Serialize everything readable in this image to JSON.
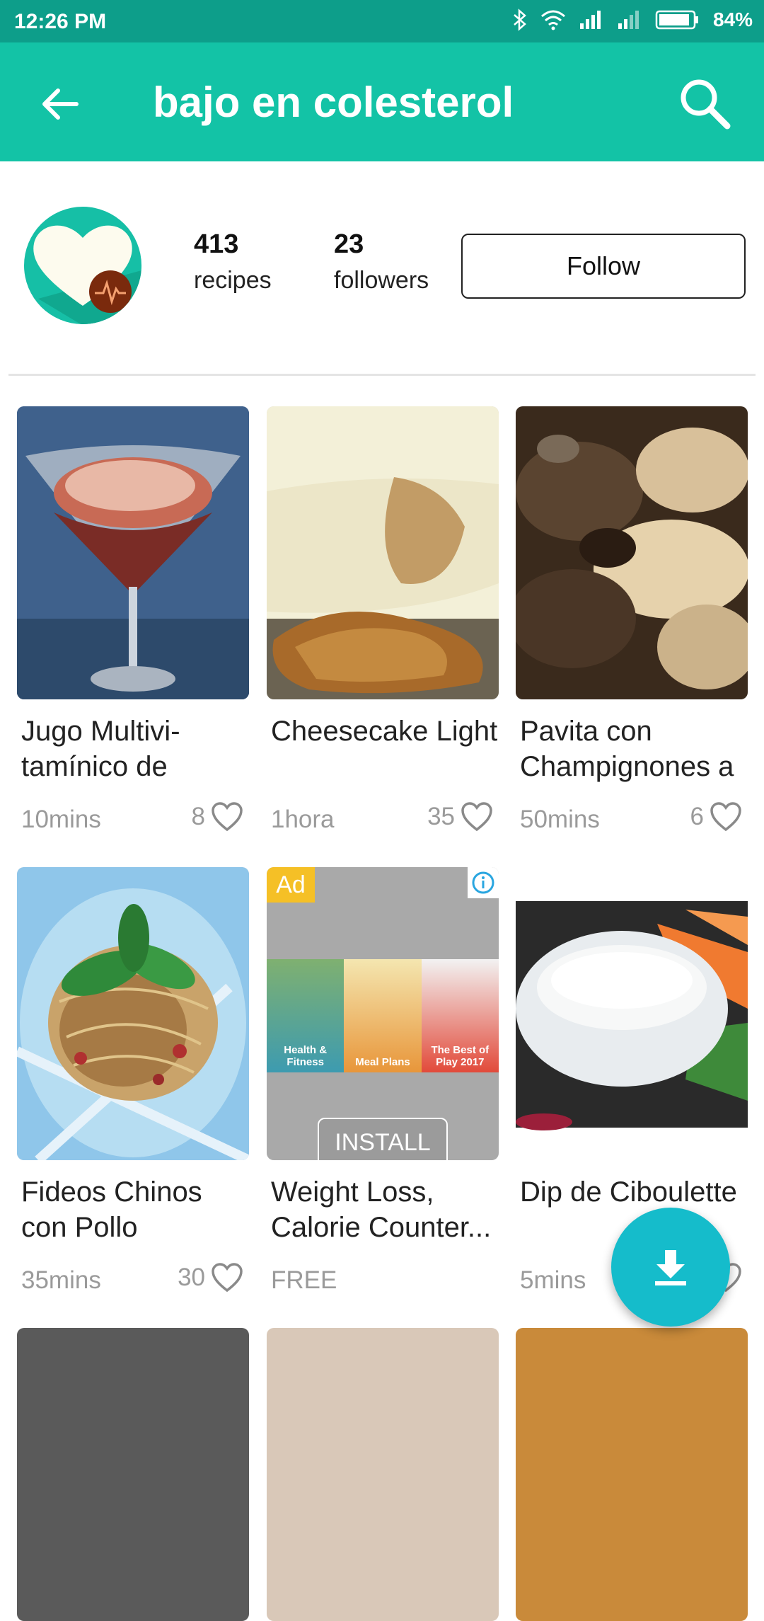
{
  "status_bar": {
    "time": "12:26 PM",
    "battery": "84%"
  },
  "app_bar": {
    "title": "bajo en colesterol",
    "back_icon": "arrow-back-icon",
    "search_icon": "search-icon"
  },
  "profile": {
    "recipes_count": "413",
    "recipes_label": "recipes",
    "followers_count": "23",
    "followers_label": "followers",
    "follow_label": "Follow"
  },
  "recipes": [
    {
      "name": "Jugo Multivi- tamínico de",
      "time": "10mins",
      "likes": "8"
    },
    {
      "name": "Cheesecake Light",
      "time": "1hora",
      "likes": "35"
    },
    {
      "name": "Pavita con Champignones a",
      "time": "50mins",
      "likes": "6"
    },
    {
      "name": "Fideos Chinos con Pollo",
      "time": "35mins",
      "likes": "30"
    },
    {
      "name": "Dip de Ciboulette",
      "time": "5mins",
      "likes": ""
    }
  ],
  "ad": {
    "badge": "Ad",
    "panels": [
      "Health & Fitness",
      "Meal Plans",
      "The Best of Play 2017"
    ],
    "install_label": "INSTALL",
    "title": "Weight Loss, Calorie Counter...",
    "price": "FREE"
  },
  "colors": {
    "status_bar": "#0d9e8a",
    "app_bar": "#13c3a6",
    "fab": "#15bccb"
  }
}
